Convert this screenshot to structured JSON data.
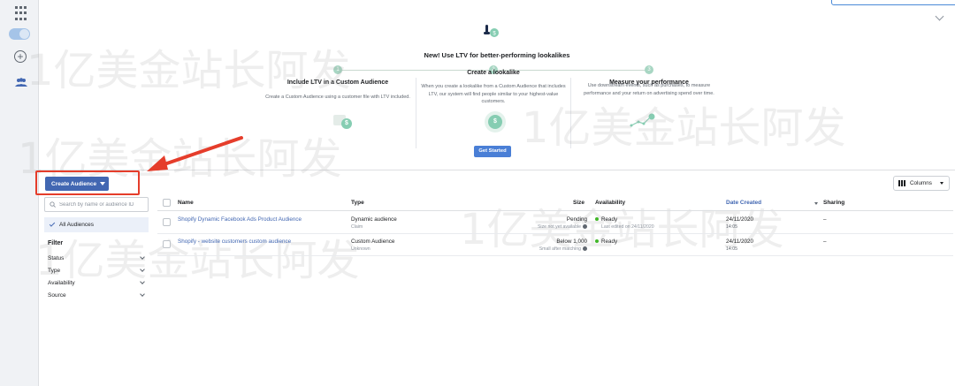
{
  "nav_rail": {
    "icons": [
      "apps-grid-icon",
      "toggle-icon",
      "add-circle-icon",
      "audiences-icon"
    ]
  },
  "promo": {
    "title": "New! Use LTV for better-performing lookalikes",
    "steps": [
      {
        "number": "1",
        "title": "Include LTV in a Custom Audience",
        "description": "Create a Custom Audience using a customer file with LTV included."
      },
      {
        "number": "2",
        "title": "Create a lookalike",
        "description": "When you create a lookalike from a Custom Audience that includes LTV, our system will find people similar to your highest-value customers."
      },
      {
        "number": "3",
        "title": "Measure your performance",
        "description": "Use downstream events, such as purchases, to measure performance and your return on advertising spend over time."
      }
    ],
    "get_started_label": "Get Started",
    "coin_symbol": "$"
  },
  "toolbar": {
    "create_audience_label": "Create Audience",
    "columns_label": "Columns"
  },
  "filters": {
    "search_placeholder": "Search by name or audience ID",
    "all_audiences_label": "All Audiences",
    "title": "Filter",
    "items": [
      "Status",
      "Type",
      "Availability",
      "Source"
    ]
  },
  "table": {
    "headers": {
      "name": "Name",
      "type": "Type",
      "size": "Size",
      "availability": "Availability",
      "date_created": "Date Created",
      "sharing": "Sharing"
    },
    "rows": [
      {
        "name": "Shopify Dynamic Facebook Ads Product Audience",
        "type": "Dynamic audience",
        "type_sub": "Claim",
        "size": "Pending",
        "size_sub": "Size not yet available",
        "availability": "Ready",
        "availability_sub": "Last edited on 24/11/2020",
        "date": "24/11/2020",
        "time": "14:05",
        "sharing": "–"
      },
      {
        "name": "Shopify - website customers custom audience",
        "type": "Custom Audience",
        "type_sub": "Unknown",
        "size": "Below 1,000",
        "size_sub": "Small after matching",
        "availability": "Ready",
        "availability_sub": "",
        "date": "24/11/2020",
        "time": "14:05",
        "sharing": "–"
      }
    ]
  },
  "watermark": "1亿美金站长阿发",
  "colors": {
    "brand_blue": "#4267b2",
    "annotation_red": "#e53d2b",
    "ready_green": "#42b72a"
  }
}
